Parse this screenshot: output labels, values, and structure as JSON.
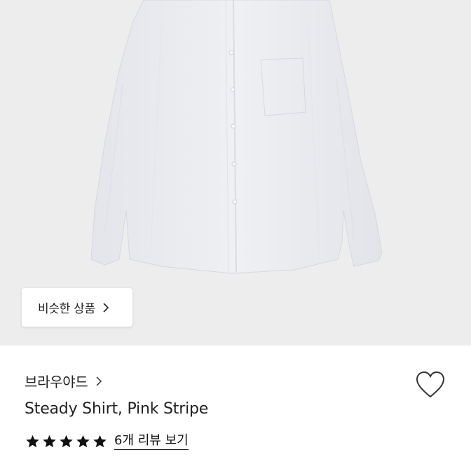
{
  "hero": {
    "image_alt": "Steady Shirt product photo",
    "similar_button_label": "비슷한 상품"
  },
  "product": {
    "brand": "브라우야드",
    "title": "Steady Shirt, Pink Stripe",
    "rating": 5,
    "rating_max": 5,
    "review_link": "6개 리뷰 보기"
  },
  "icons": {
    "similar_chevron": "chevron-right-icon",
    "brand_chevron": "chevron-right-icon",
    "wishlist": "heart-outline-icon",
    "rating_star": "star-filled-icon"
  },
  "colors": {
    "hero_background": "#ededee",
    "star": "#111111"
  }
}
